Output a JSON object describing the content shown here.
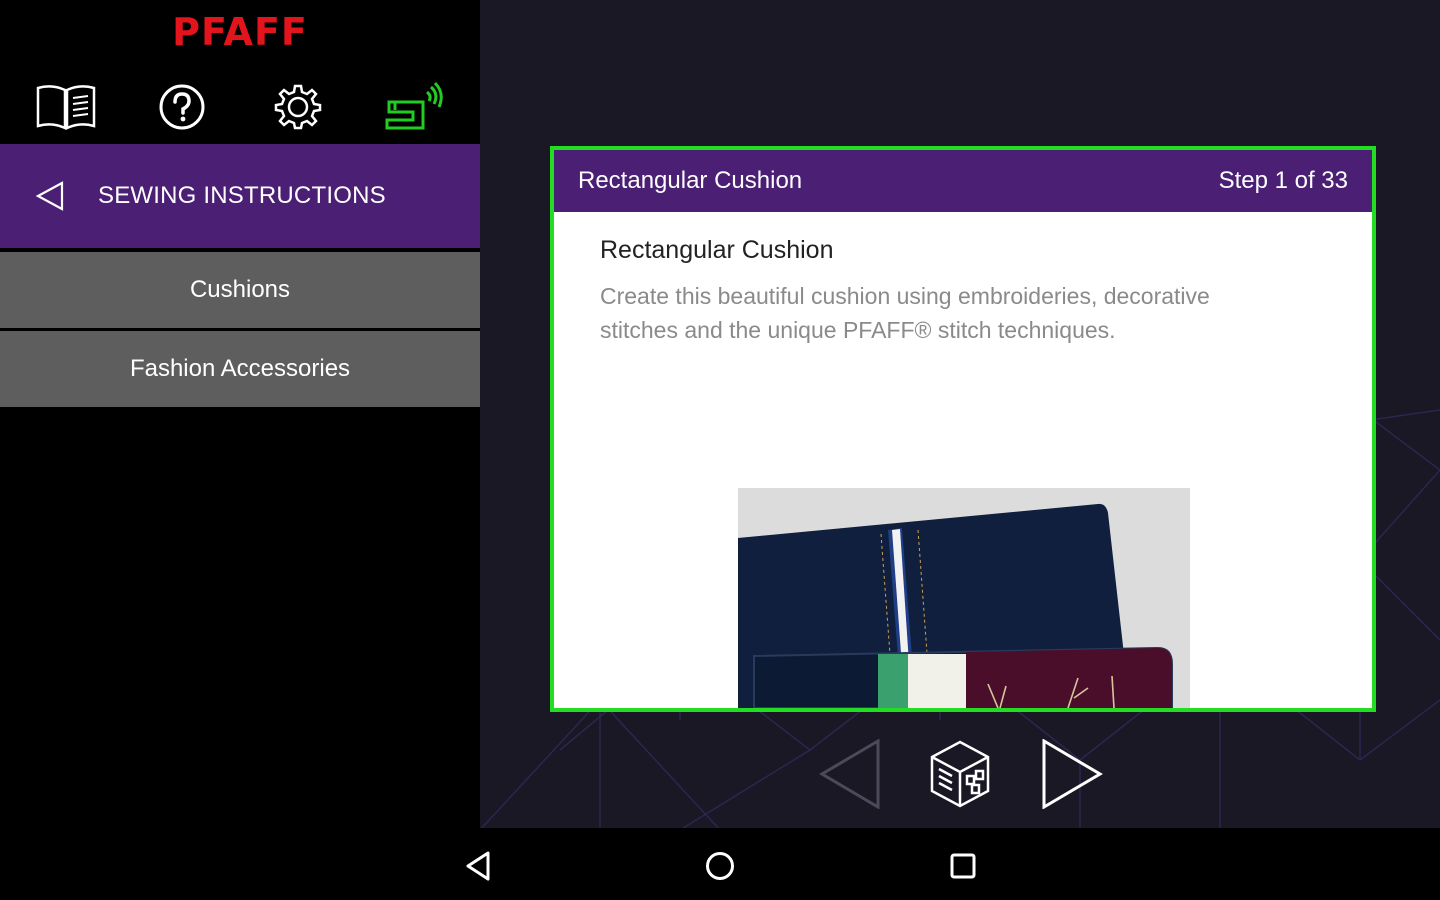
{
  "app": {
    "brand": "PFAFF"
  },
  "toolbar": {
    "items": [
      {
        "name": "manual-icon"
      },
      {
        "name": "help-icon"
      },
      {
        "name": "gear-icon"
      },
      {
        "name": "sewing-machine-connected-icon"
      }
    ]
  },
  "sidebar": {
    "section_title": "SEWING INSTRUCTIONS",
    "categories": [
      {
        "label": "Cushions"
      },
      {
        "label": "Fashion Accessories"
      }
    ]
  },
  "card": {
    "header_title": "Rectangular Cushion",
    "step_text": "Step 1 of 33",
    "title": "Rectangular Cushion",
    "description": "Create this beautiful cushion using embroideries, decorative stitches and the unique PFAFF® stitch techniques."
  },
  "navigation": {
    "prev": "triangle-left-icon",
    "center": "3d-cube-icon",
    "next": "triangle-right-icon"
  },
  "colors": {
    "brand_red": "#e3141c",
    "purple": "#4a1f74",
    "active_green": "#22dd22",
    "category_gray": "#5e5e5e"
  }
}
